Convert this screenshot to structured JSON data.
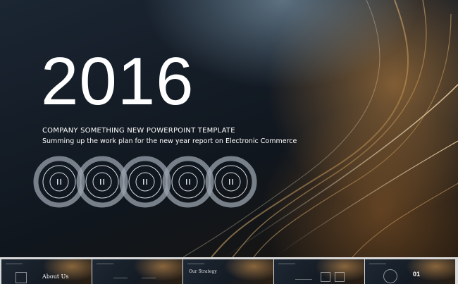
{
  "slide": {
    "year": "2016",
    "company_line": "COMPANY SOMETHING NEW POWERPOINT TEMPLATE",
    "subtitle_line": "Summing up the work plan for the new year report on Electronic Commerce",
    "rings": [
      {
        "icon": "pause-icon"
      },
      {
        "icon": "pause-icon"
      },
      {
        "icon": "pause-icon"
      },
      {
        "icon": "pause-icon"
      },
      {
        "icon": "pause-icon"
      }
    ]
  },
  "thumbnails": {
    "items": [
      {
        "title": "About Us"
      },
      {
        "title": ""
      },
      {
        "title": "Our Strategy"
      },
      {
        "title": ""
      },
      {
        "title": "01"
      }
    ]
  }
}
